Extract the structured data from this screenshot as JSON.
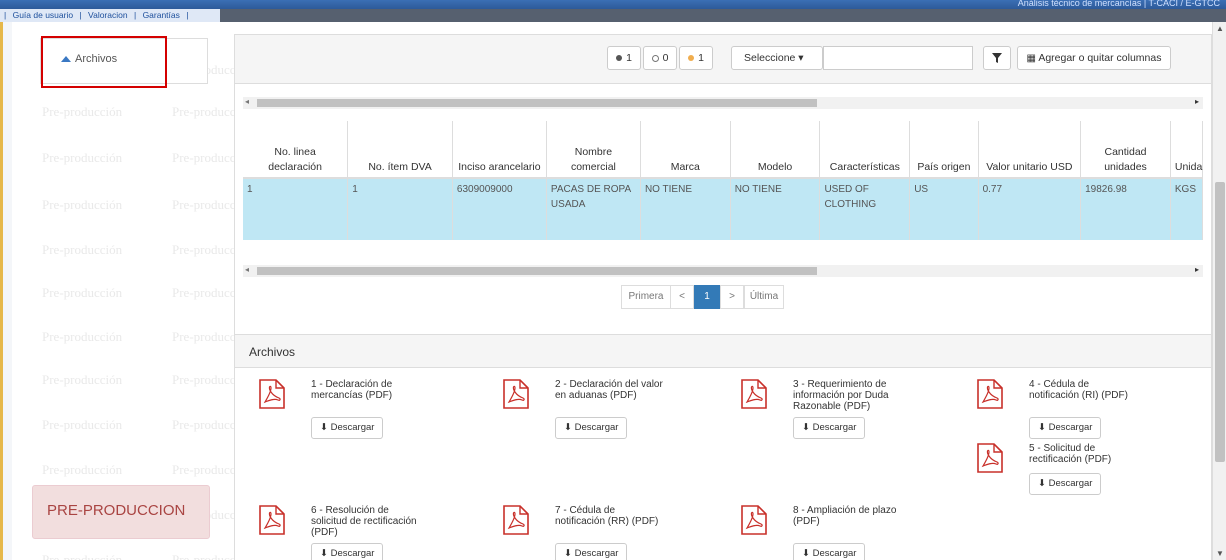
{
  "topbar": {
    "title": "Análisis técnico de mercancías | T-CACI / E-GTCC"
  },
  "menu": {
    "items": [
      "Guía de usuario",
      "Valoracion",
      "Garantías"
    ]
  },
  "archivos_toggle": {
    "label": "Archivos"
  },
  "environment_badge": {
    "label": "PRE-PRODUCCION"
  },
  "watermark": "Pre-producción",
  "toolbar": {
    "counter1": "1",
    "counter2": "0",
    "counter3": "1",
    "select_label": "Seleccione",
    "columns_button": "Agregar o quitar columnas"
  },
  "table": {
    "headers": [
      "No. linea declaración",
      "No. ítem DVA",
      "Inciso arancelario",
      "Nombre comercial",
      "Marca",
      "Modelo",
      "Características",
      "País origen",
      "Valor unitario USD",
      "Cantidad unidades",
      "Unida"
    ],
    "rows": [
      [
        "1",
        "1",
        "6309009000",
        "PACAS DE ROPA USADA",
        "NO TIENE",
        "NO TIENE",
        "USED OF CLOTHING",
        "US",
        "0.77",
        "19826.98",
        "KGS"
      ]
    ]
  },
  "pagination": {
    "first": "Primera",
    "prev": "<",
    "current": "1",
    "next": ">",
    "last": "Última"
  },
  "files": {
    "heading": "Archivos",
    "download_label": "Descargar",
    "items": [
      {
        "title": "1 - Declaración de mercancías (PDF)"
      },
      {
        "title": "2 - Declaración del valor en aduanas (PDF)"
      },
      {
        "title": "3 - Requerimiento de información por Duda Razonable (PDF)"
      },
      {
        "title": "4 - Cédula de notificación (RI) (PDF)"
      },
      {
        "title": "5 - Solicitud de rectificación (PDF)"
      },
      {
        "title": "6 - Resolución de solicitud de rectificación (PDF)"
      },
      {
        "title": "7 - Cédula de notificación (RR) (PDF)"
      },
      {
        "title": "8 - Ampliación de plazo (PDF)"
      }
    ]
  },
  "colors": {
    "accent": "#337ab7",
    "row_selected": "#bfe7f4",
    "highlight_box": "#d40000"
  }
}
